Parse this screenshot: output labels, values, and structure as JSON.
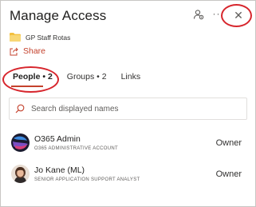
{
  "header": {
    "title": "Manage Access",
    "icons": [
      "person-settings-icon",
      "more-icon",
      "close-icon"
    ],
    "more_glyph": "···",
    "close_glyph": "✕"
  },
  "file": {
    "name": "GP Staff Rotas",
    "icon": "folder-icon"
  },
  "share": {
    "label": "Share",
    "icon": "share-icon"
  },
  "tabs": [
    {
      "label": "People • 2",
      "active": true
    },
    {
      "label": "Groups • 2",
      "active": false
    },
    {
      "label": "Links",
      "active": false
    }
  ],
  "search": {
    "placeholder": "Search displayed names",
    "value": ""
  },
  "people": [
    {
      "name": "O365 Admin",
      "role": "O365 ADMINISTRATIVE ACCOUNT",
      "permission": "Owner"
    },
    {
      "name": "Jo Kane (ML)",
      "role": "SENIOR APPLICATION SUPPORT ANALYST",
      "permission": "Owner"
    }
  ],
  "colors": {
    "accent": "#c4412c",
    "highlight_ring": "#d7262d",
    "folder": "#f3c03f"
  }
}
